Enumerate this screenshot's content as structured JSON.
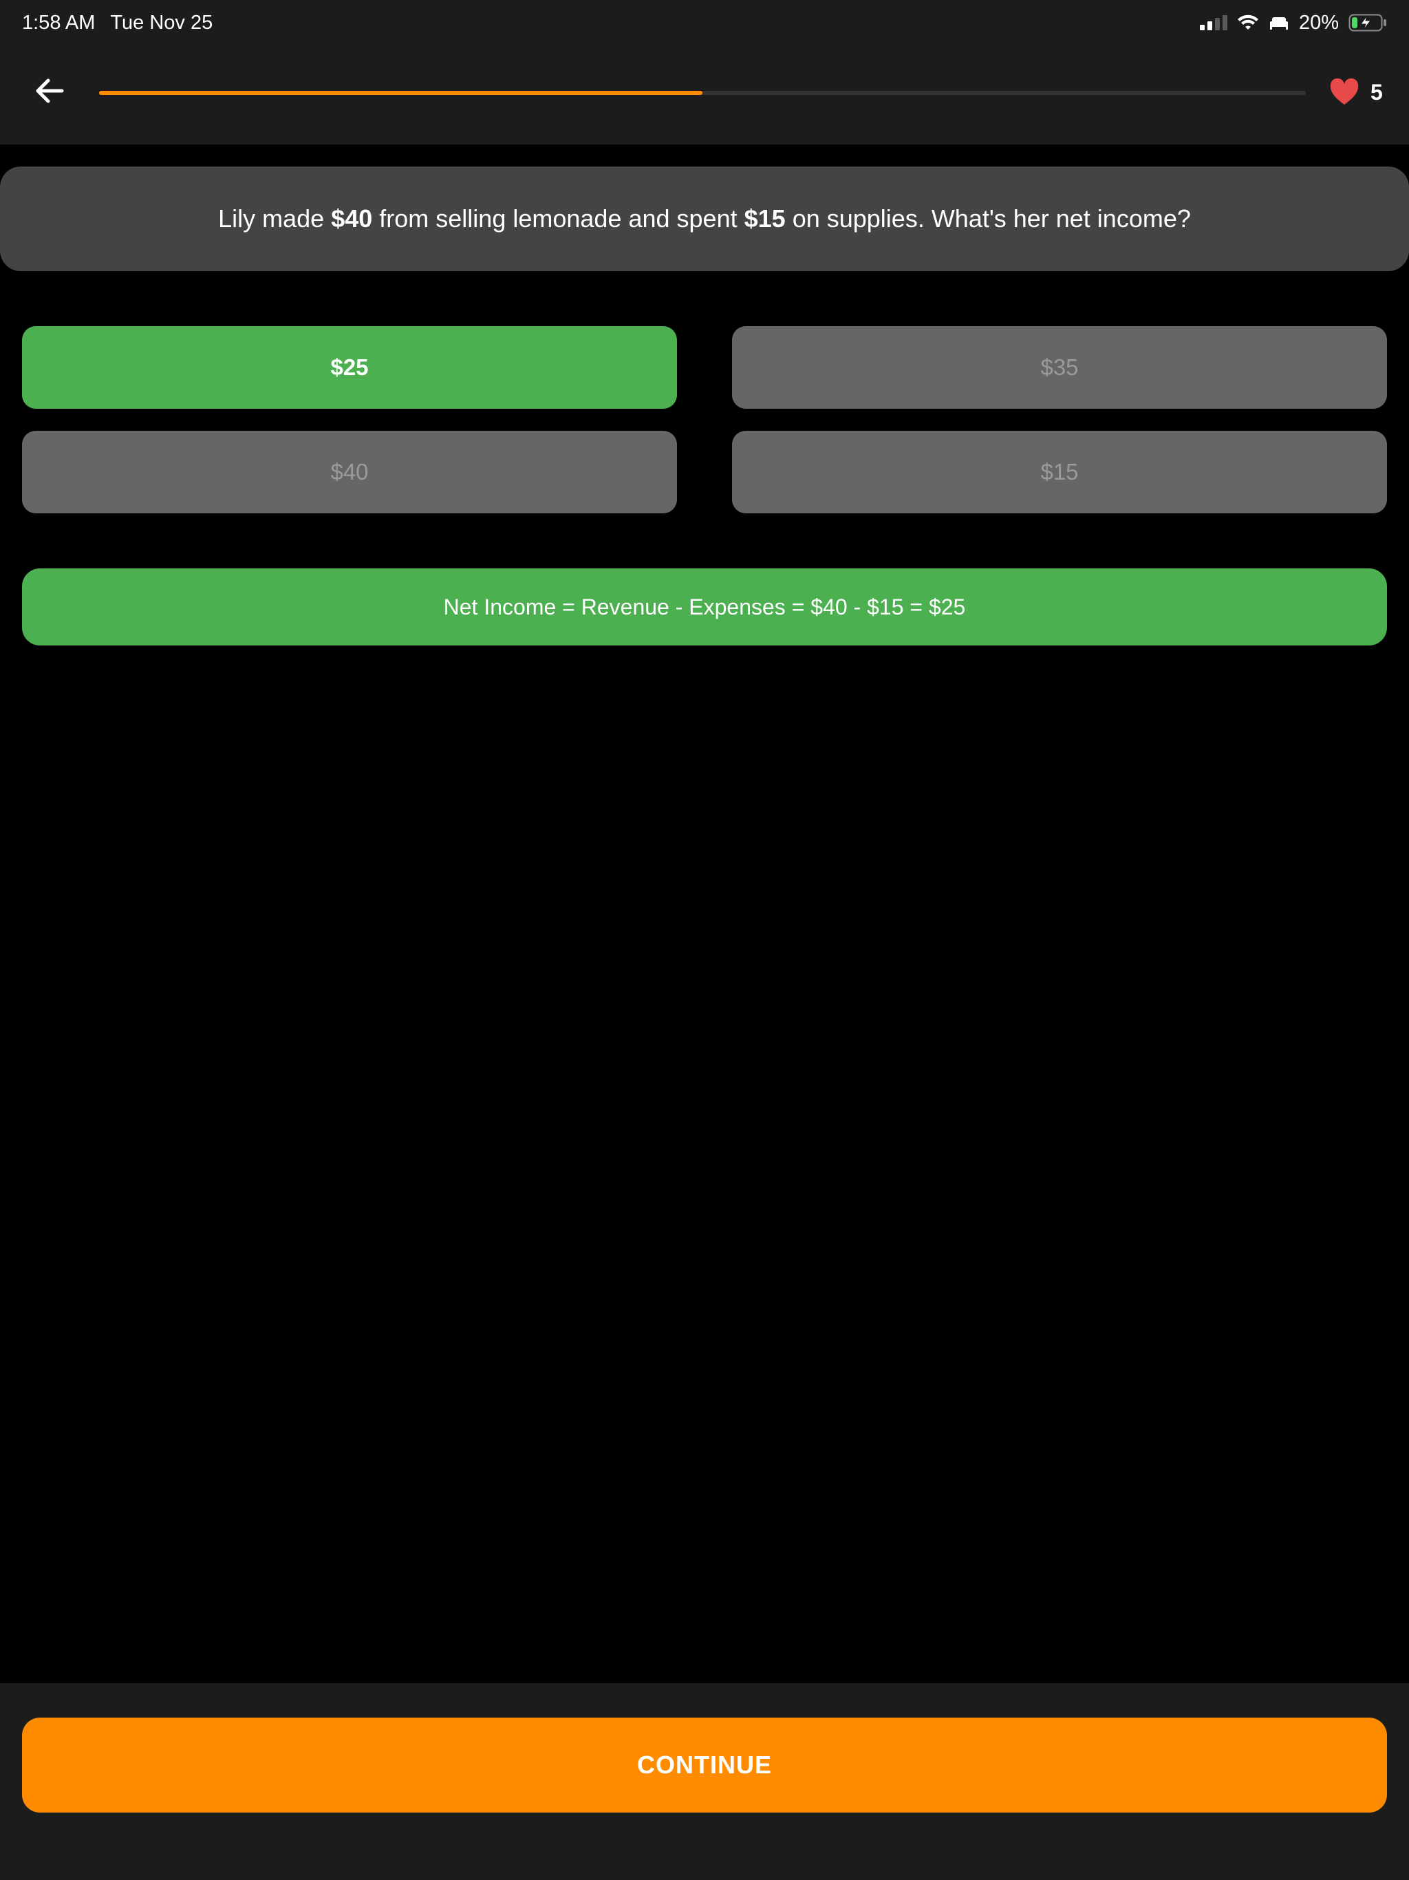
{
  "status_bar": {
    "time": "1:58 AM",
    "date": "Tue Nov 25",
    "battery_percent": "20%",
    "battery_level": 0.2,
    "icons": [
      "cellular-signal-icon",
      "wifi-icon",
      "sleep-focus-icon",
      "battery-charging-icon"
    ]
  },
  "nav": {
    "back_icon": "arrow-left-icon",
    "progress_fraction": 0.5,
    "progress_color": "#ff8c00",
    "lives_icon": "heart-icon",
    "lives_count": "5"
  },
  "question": {
    "part1": "Lily made ",
    "amount1": "$40",
    "part2": " from selling lemonade and spent ",
    "amount2": "$15",
    "part3": " on supplies. What's her net income?"
  },
  "answers": [
    {
      "label": "$25",
      "state": "correct"
    },
    {
      "label": "$35",
      "state": "dimmed"
    },
    {
      "label": "$40",
      "state": "dimmed"
    },
    {
      "label": "$15",
      "state": "dimmed"
    }
  ],
  "explanation": "Net Income = Revenue - Expenses = $40 - $15 = $25",
  "continue_label": "CONTINUE",
  "colors": {
    "correct": "#4caf50",
    "accent": "#ff8c00",
    "heart": "#e84a4a"
  }
}
